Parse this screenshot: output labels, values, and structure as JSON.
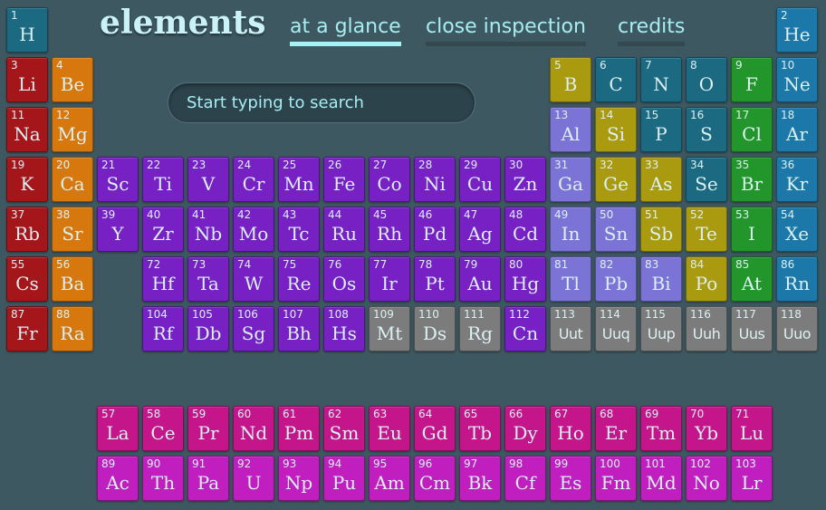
{
  "header": {
    "logo": "elements",
    "nav": [
      {
        "label": "at a glance",
        "active": true
      },
      {
        "label": "close inspection",
        "active": false
      },
      {
        "label": "credits",
        "active": false
      }
    ]
  },
  "search": {
    "placeholder": "Start typing to search",
    "value": ""
  },
  "category_colors": {
    "nonmetal": "#1b6a82",
    "noble": "#1b78a8",
    "alkali": "#a5161b",
    "alkaline": "#d6780e",
    "metalloid": "#a99a0f",
    "halogen": "#22962b",
    "post": "#7b74d6",
    "transition": "#7720c4",
    "unknown": "#7c7c7c",
    "lanthanide": "#c4168a",
    "actinide": "#c01ebe"
  },
  "elements": [
    [
      1,
      "H",
      "nonmetal"
    ],
    [
      2,
      "He",
      "noble"
    ],
    [
      3,
      "Li",
      "alkali"
    ],
    [
      4,
      "Be",
      "alkaline"
    ],
    [
      5,
      "B",
      "metalloid"
    ],
    [
      6,
      "C",
      "nonmetal"
    ],
    [
      7,
      "N",
      "nonmetal"
    ],
    [
      8,
      "O",
      "nonmetal"
    ],
    [
      9,
      "F",
      "halogen"
    ],
    [
      10,
      "Ne",
      "noble"
    ],
    [
      11,
      "Na",
      "alkali"
    ],
    [
      12,
      "Mg",
      "alkaline"
    ],
    [
      13,
      "Al",
      "post"
    ],
    [
      14,
      "Si",
      "metalloid"
    ],
    [
      15,
      "P",
      "nonmetal"
    ],
    [
      16,
      "S",
      "nonmetal"
    ],
    [
      17,
      "Cl",
      "halogen"
    ],
    [
      18,
      "Ar",
      "noble"
    ],
    [
      19,
      "K",
      "alkali"
    ],
    [
      20,
      "Ca",
      "alkaline"
    ],
    [
      21,
      "Sc",
      "transition"
    ],
    [
      22,
      "Ti",
      "transition"
    ],
    [
      23,
      "V",
      "transition"
    ],
    [
      24,
      "Cr",
      "transition"
    ],
    [
      25,
      "Mn",
      "transition"
    ],
    [
      26,
      "Fe",
      "transition"
    ],
    [
      27,
      "Co",
      "transition"
    ],
    [
      28,
      "Ni",
      "transition"
    ],
    [
      29,
      "Cu",
      "transition"
    ],
    [
      30,
      "Zn",
      "transition"
    ],
    [
      31,
      "Ga",
      "post"
    ],
    [
      32,
      "Ge",
      "metalloid"
    ],
    [
      33,
      "As",
      "metalloid"
    ],
    [
      34,
      "Se",
      "nonmetal"
    ],
    [
      35,
      "Br",
      "halogen"
    ],
    [
      36,
      "Kr",
      "noble"
    ],
    [
      37,
      "Rb",
      "alkali"
    ],
    [
      38,
      "Sr",
      "alkaline"
    ],
    [
      39,
      "Y",
      "transition"
    ],
    [
      40,
      "Zr",
      "transition"
    ],
    [
      41,
      "Nb",
      "transition"
    ],
    [
      42,
      "Mo",
      "transition"
    ],
    [
      43,
      "Tc",
      "transition"
    ],
    [
      44,
      "Ru",
      "transition"
    ],
    [
      45,
      "Rh",
      "transition"
    ],
    [
      46,
      "Pd",
      "transition"
    ],
    [
      47,
      "Ag",
      "transition"
    ],
    [
      48,
      "Cd",
      "transition"
    ],
    [
      49,
      "In",
      "post"
    ],
    [
      50,
      "Sn",
      "post"
    ],
    [
      51,
      "Sb",
      "metalloid"
    ],
    [
      52,
      "Te",
      "metalloid"
    ],
    [
      53,
      "I",
      "halogen"
    ],
    [
      54,
      "Xe",
      "noble"
    ],
    [
      55,
      "Cs",
      "alkali"
    ],
    [
      56,
      "Ba",
      "alkaline"
    ],
    [
      57,
      "La",
      "lanthanide"
    ],
    [
      58,
      "Ce",
      "lanthanide"
    ],
    [
      59,
      "Pr",
      "lanthanide"
    ],
    [
      60,
      "Nd",
      "lanthanide"
    ],
    [
      61,
      "Pm",
      "lanthanide"
    ],
    [
      62,
      "Sm",
      "lanthanide"
    ],
    [
      63,
      "Eu",
      "lanthanide"
    ],
    [
      64,
      "Gd",
      "lanthanide"
    ],
    [
      65,
      "Tb",
      "lanthanide"
    ],
    [
      66,
      "Dy",
      "lanthanide"
    ],
    [
      67,
      "Ho",
      "lanthanide"
    ],
    [
      68,
      "Er",
      "lanthanide"
    ],
    [
      69,
      "Tm",
      "lanthanide"
    ],
    [
      70,
      "Yb",
      "lanthanide"
    ],
    [
      71,
      "Lu",
      "lanthanide"
    ],
    [
      72,
      "Hf",
      "transition"
    ],
    [
      73,
      "Ta",
      "transition"
    ],
    [
      74,
      "W",
      "transition"
    ],
    [
      75,
      "Re",
      "transition"
    ],
    [
      76,
      "Os",
      "transition"
    ],
    [
      77,
      "Ir",
      "transition"
    ],
    [
      78,
      "Pt",
      "transition"
    ],
    [
      79,
      "Au",
      "transition"
    ],
    [
      80,
      "Hg",
      "transition"
    ],
    [
      81,
      "Tl",
      "post"
    ],
    [
      82,
      "Pb",
      "post"
    ],
    [
      83,
      "Bi",
      "post"
    ],
    [
      84,
      "Po",
      "metalloid"
    ],
    [
      85,
      "At",
      "halogen"
    ],
    [
      86,
      "Rn",
      "noble"
    ],
    [
      87,
      "Fr",
      "alkali"
    ],
    [
      88,
      "Ra",
      "alkaline"
    ],
    [
      89,
      "Ac",
      "actinide"
    ],
    [
      90,
      "Th",
      "actinide"
    ],
    [
      91,
      "Pa",
      "actinide"
    ],
    [
      92,
      "U",
      "actinide"
    ],
    [
      93,
      "Np",
      "actinide"
    ],
    [
      94,
      "Pu",
      "actinide"
    ],
    [
      95,
      "Am",
      "actinide"
    ],
    [
      96,
      "Cm",
      "actinide"
    ],
    [
      97,
      "Bk",
      "actinide"
    ],
    [
      98,
      "Cf",
      "actinide"
    ],
    [
      99,
      "Es",
      "actinide"
    ],
    [
      100,
      "Fm",
      "actinide"
    ],
    [
      101,
      "Md",
      "actinide"
    ],
    [
      102,
      "No",
      "actinide"
    ],
    [
      103,
      "Lr",
      "actinide"
    ],
    [
      104,
      "Rf",
      "transition"
    ],
    [
      105,
      "Db",
      "transition"
    ],
    [
      106,
      "Sg",
      "transition"
    ],
    [
      107,
      "Bh",
      "transition"
    ],
    [
      108,
      "Hs",
      "transition"
    ],
    [
      109,
      "Mt",
      "unknown"
    ],
    [
      110,
      "Ds",
      "unknown"
    ],
    [
      111,
      "Rg",
      "unknown"
    ],
    [
      112,
      "Cn",
      "transition"
    ],
    [
      113,
      "Uut",
      "unknown"
    ],
    [
      114,
      "Uuq",
      "unknown"
    ],
    [
      115,
      "Uup",
      "unknown"
    ],
    [
      116,
      "Uuh",
      "unknown"
    ],
    [
      117,
      "Uus",
      "unknown"
    ],
    [
      118,
      "Uuo",
      "unknown"
    ]
  ]
}
